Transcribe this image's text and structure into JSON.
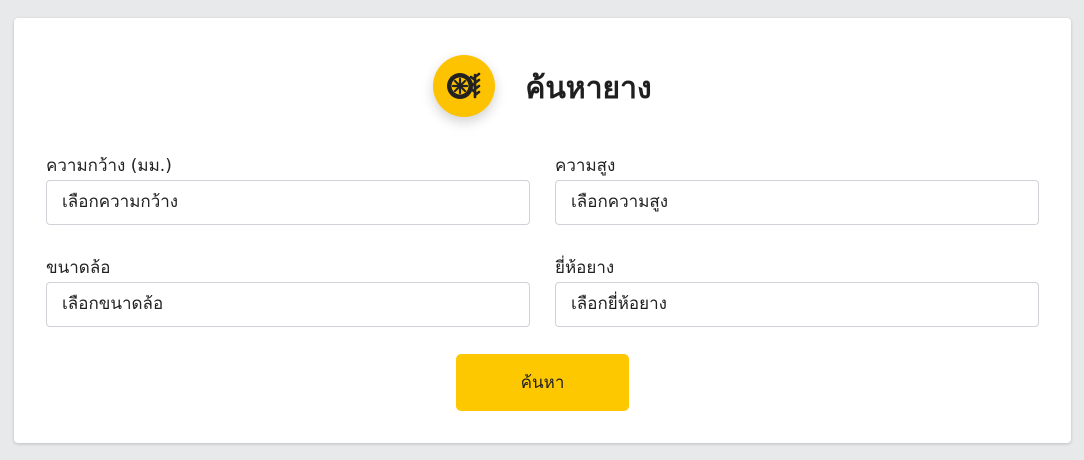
{
  "header": {
    "title": "ค้นหายาง",
    "logo_icon": "tire-icon",
    "accent_color": "#fdc300"
  },
  "form": {
    "width": {
      "label": "ความกว้าง (มม.)",
      "value": "เลือกความกว้าง"
    },
    "height": {
      "label": "ความสูง",
      "value": "เลือกความสูง"
    },
    "wheel_size": {
      "label": "ขนาดล้อ",
      "value": "เลือกขนาดล้อ"
    },
    "brand": {
      "label": "ยี่ห้อยาง",
      "value": "เลือกยี่ห้อยาง"
    },
    "search_label": "ค้นหา"
  }
}
